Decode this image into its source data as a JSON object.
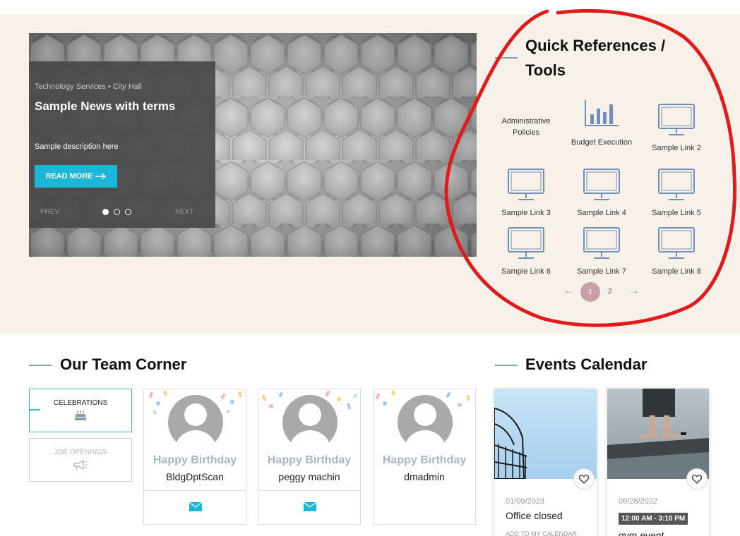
{
  "hero": {
    "category": "Technology Services • City Hall",
    "title": "Sample News with terms",
    "description": "Sample description here",
    "read_more_label": "READ MORE",
    "prev_label": "PREV",
    "next_label": "NEXT",
    "slide_count": 3,
    "active_slide": 1
  },
  "quick_refs": {
    "title": "Quick References / Tools",
    "items": [
      {
        "label": "Administrative Policies",
        "icon": "none"
      },
      {
        "label": "Budget Execution",
        "icon": "bar-chart-icon"
      },
      {
        "label": "Sample Link 2",
        "icon": "monitor-icon"
      },
      {
        "label": "Sample Link 3",
        "icon": "monitor-icon"
      },
      {
        "label": "Sample Link 4",
        "icon": "monitor-icon"
      },
      {
        "label": "Sample Link 5",
        "icon": "monitor-icon"
      },
      {
        "label": "Sample Link 6",
        "icon": "monitor-icon"
      },
      {
        "label": "Sample Link 7",
        "icon": "monitor-icon"
      },
      {
        "label": "Sample Link 8",
        "icon": "monitor-icon"
      }
    ],
    "pager": {
      "page1": "1",
      "page2": "2",
      "current": "1"
    }
  },
  "team": {
    "title": "Our Team Corner",
    "tabs": [
      {
        "label": "CELEBRATIONS",
        "active": true
      },
      {
        "label": "JOB OPENINGS",
        "active": false
      }
    ],
    "birthdays": [
      {
        "greeting": "Happy Birthday",
        "name": "BldgDptScan",
        "has_mail": true
      },
      {
        "greeting": "Happy Birthday",
        "name": "peggy machin",
        "has_mail": true
      },
      {
        "greeting": "Happy Birthday",
        "name": "dmadmin",
        "has_mail": false
      }
    ]
  },
  "events": {
    "title": "Events Calendar",
    "items": [
      {
        "date": "01/09/2023",
        "title": "Office closed",
        "link": "ADD TO MY CALENDAR"
      },
      {
        "date": "09/28/2022",
        "time": "12:00 AM - 3:10 PM",
        "title": "gym event"
      }
    ]
  },
  "colors": {
    "accent": "#1cb7d6",
    "band": "#f7f1ea",
    "annotation": "#e01b1b",
    "icon": "#6f8fb5"
  }
}
